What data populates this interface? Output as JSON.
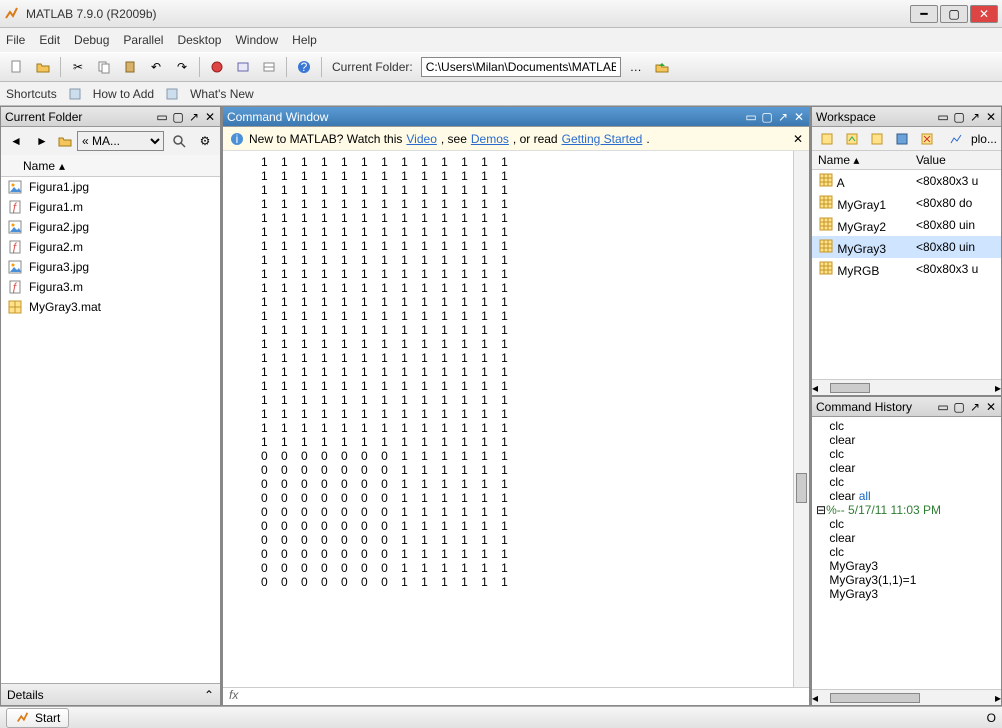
{
  "window": {
    "title": "MATLAB 7.9.0 (R2009b)"
  },
  "menu": [
    "File",
    "Edit",
    "Debug",
    "Parallel",
    "Desktop",
    "Window",
    "Help"
  ],
  "toolbar": {
    "current_folder_label": "Current Folder:",
    "current_folder_value": "C:\\Users\\Milan\\Documents\\MATLAB"
  },
  "shortcuts": [
    "Shortcuts",
    "How to Add",
    "What's New"
  ],
  "current_folder_panel": {
    "title": "Current Folder",
    "breadcrumb": "« MA...",
    "name_header": "Name",
    "files": [
      {
        "name": "Figura1.jpg",
        "type": "jpg"
      },
      {
        "name": "Figura1.m",
        "type": "m"
      },
      {
        "name": "Figura2.jpg",
        "type": "jpg"
      },
      {
        "name": "Figura2.m",
        "type": "m"
      },
      {
        "name": "Figura3.jpg",
        "type": "jpg"
      },
      {
        "name": "Figura3.m",
        "type": "m"
      },
      {
        "name": "MyGray3.mat",
        "type": "mat"
      }
    ],
    "details": "Details"
  },
  "command_window": {
    "title": "Command Window",
    "info_prefix": "New to MATLAB? Watch this ",
    "video_link": "Video",
    "mid1": ", see ",
    "demos_link": "Demos",
    "mid2": ", or read ",
    "getting_link": "Getting Started",
    "period": ".",
    "fx": "fx",
    "matrix": {
      "rows": 31,
      "cols": 13,
      "ones_cutoff_row": 21,
      "zeros_until_col": 7
    }
  },
  "workspace": {
    "title": "Workspace",
    "plot_label": "plo...",
    "name_header": "Name",
    "value_header": "Value",
    "vars": [
      {
        "name": "A",
        "value": "<80x80x3 u",
        "icon": "matrix",
        "selected": false
      },
      {
        "name": "MyGray1",
        "value": "<80x80 do",
        "icon": "matrix",
        "selected": false
      },
      {
        "name": "MyGray2",
        "value": "<80x80 uin",
        "icon": "matrix",
        "selected": false
      },
      {
        "name": "MyGray3",
        "value": "<80x80 uin",
        "icon": "matrix",
        "selected": true
      },
      {
        "name": "MyRGB",
        "value": "<80x80x3 u",
        "icon": "matrix",
        "selected": false
      }
    ]
  },
  "command_history": {
    "title": "Command History",
    "lines": [
      {
        "text": "clc",
        "kw": false
      },
      {
        "text": "clear",
        "kw": false
      },
      {
        "text": "clc",
        "kw": false
      },
      {
        "text": "clear",
        "kw": false
      },
      {
        "text": "clc",
        "kw": false
      },
      {
        "text": "clear all",
        "kw": "all"
      },
      {
        "text": "%-- 5/17/11 11:03 PM ",
        "green": true
      },
      {
        "text": "clc",
        "kw": false
      },
      {
        "text": "clear",
        "kw": false
      },
      {
        "text": "clc",
        "kw": false
      },
      {
        "text": "MyGray3",
        "kw": false
      },
      {
        "text": "MyGray3(1,1)=1",
        "kw": false
      },
      {
        "text": "MyGray3",
        "kw": false
      }
    ]
  },
  "status": {
    "start": "Start",
    "ok": "O"
  }
}
